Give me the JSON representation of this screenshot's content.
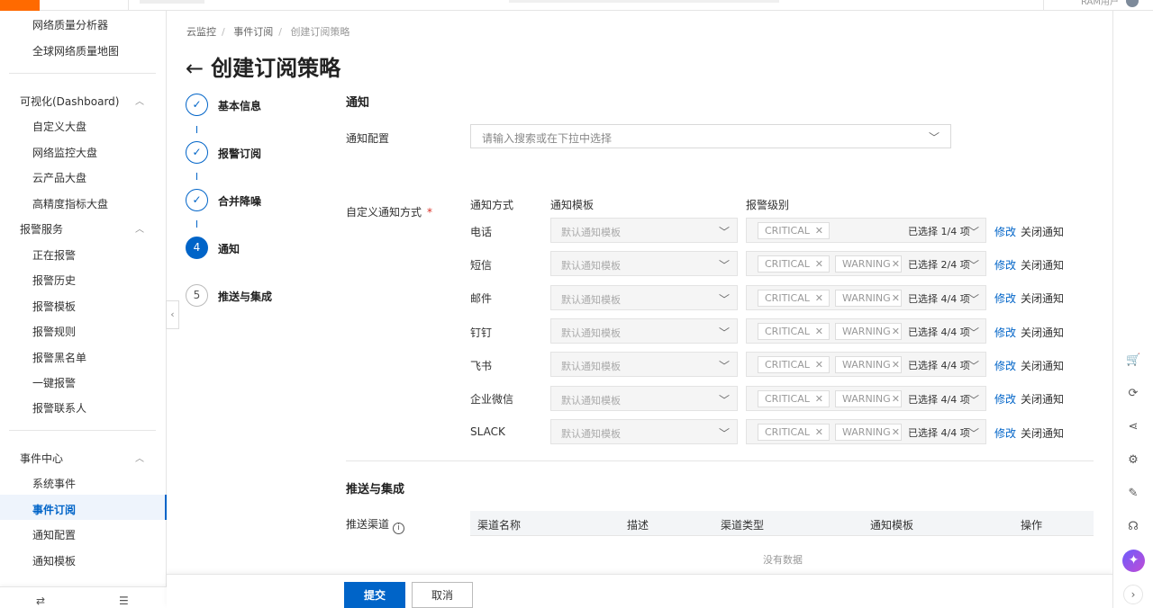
{
  "topbar": {
    "user": "RAM用户"
  },
  "sidebar": {
    "items_top": [
      "网络质量分析器",
      "全球网络质量地图"
    ],
    "dashboard_group": "可视化(Dashboard)",
    "dashboard_items": [
      "自定义大盘",
      "网络监控大盘",
      "云产品大盘",
      "高精度指标大盘"
    ],
    "alert_group": "报警服务",
    "alert_items": [
      "正在报警",
      "报警历史",
      "报警模板",
      "报警规则",
      "报警黑名单",
      "一键报警",
      "报警联系人"
    ],
    "event_group": "事件中心",
    "event_items": [
      "系统事件",
      "事件订阅",
      "通知配置",
      "通知模板"
    ],
    "active_item": "事件订阅"
  },
  "breadcrumb": [
    "云监控",
    "事件订阅",
    "创建订阅策略"
  ],
  "page_title": "创建订阅策略",
  "steps": [
    {
      "num": "1",
      "label": "基本信息",
      "state": "done"
    },
    {
      "num": "2",
      "label": "报警订阅",
      "state": "done"
    },
    {
      "num": "3",
      "label": "合并降噪",
      "state": "done"
    },
    {
      "num": "4",
      "label": "通知",
      "state": "active"
    },
    {
      "num": "5",
      "label": "推送与集成",
      "state": "todo"
    }
  ],
  "notify": {
    "section_title": "通知",
    "config_label": "通知配置",
    "config_placeholder": "请输入搜索或在下拉中选择",
    "custom_label": "自定义通知方式",
    "columns": {
      "method": "通知方式",
      "template": "通知模板",
      "level": "报警级别"
    },
    "template_placeholder": "默认通知模板",
    "edit_label": "修改",
    "close_label": "关闭通知",
    "rows": [
      {
        "method": "电话",
        "tags": [
          "CRITICAL"
        ],
        "count": "已选择 1/4 项"
      },
      {
        "method": "短信",
        "tags": [
          "CRITICAL",
          "WARNING"
        ],
        "count": "已选择 2/4 项"
      },
      {
        "method": "邮件",
        "tags": [
          "CRITICAL",
          "WARNING"
        ],
        "count": "已选择 4/4 项"
      },
      {
        "method": "钉钉",
        "tags": [
          "CRITICAL",
          "WARNING"
        ],
        "count": "已选择 4/4 项"
      },
      {
        "method": "飞书",
        "tags": [
          "CRITICAL",
          "WARNING"
        ],
        "count": "已选择 4/4 项"
      },
      {
        "method": "企业微信",
        "tags": [
          "CRITICAL",
          "WARNING"
        ],
        "count": "已选择 4/4 项"
      },
      {
        "method": "SLACK",
        "tags": [
          "CRITICAL",
          "WARNING"
        ],
        "count": "已选择 4/4 项"
      }
    ]
  },
  "push": {
    "section_title": "推送与集成",
    "channel_label": "推送渠道",
    "table_headers": [
      "渠道名称",
      "描述",
      "渠道类型",
      "通知模板",
      "操作"
    ],
    "empty_text": "没有数据"
  },
  "footer": {
    "submit": "提交",
    "cancel": "取消"
  },
  "colors": {
    "primary": "#0064c8",
    "required": "#d93026"
  }
}
